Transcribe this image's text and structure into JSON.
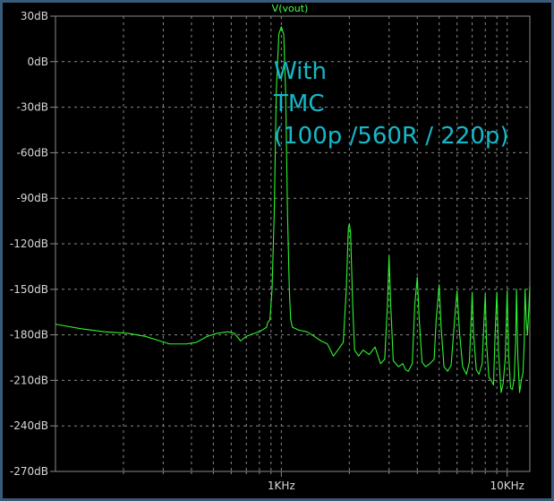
{
  "window": {
    "trace_label": "V(vout)"
  },
  "colors": {
    "background": "#000000",
    "grid": "#8a8a8a",
    "trace": "#2ef52e",
    "annotation": "#16b8c8",
    "axis_text": "#d8d8d8",
    "frame": "#3a5a7a"
  },
  "chart_data": {
    "type": "line",
    "title": "V(vout)",
    "xscale": "log",
    "xlim": [
      100,
      12600
    ],
    "ylim": [
      -270,
      30
    ],
    "x_ticks": [
      {
        "value": 1000,
        "label": "1KHz"
      },
      {
        "value": 10000,
        "label": "10KHz"
      }
    ],
    "y_ticks": [
      {
        "value": 30,
        "label": "30dB"
      },
      {
        "value": 0,
        "label": "0dB"
      },
      {
        "value": -30,
        "label": "-30dB"
      },
      {
        "value": -60,
        "label": "-60dB"
      },
      {
        "value": -90,
        "label": "-90dB"
      },
      {
        "value": -120,
        "label": "-120dB"
      },
      {
        "value": -150,
        "label": "-150dB"
      },
      {
        "value": -180,
        "label": "-180dB"
      },
      {
        "value": -210,
        "label": "-210dB"
      },
      {
        "value": -240,
        "label": "-240dB"
      },
      {
        "value": -270,
        "label": "-270dB"
      }
    ],
    "grid": true,
    "annotation": [
      "With",
      "TMC",
      "(100p /560R / 220p)"
    ],
    "series": [
      {
        "points": [
          [
            100,
            -173
          ],
          [
            130,
            -176
          ],
          [
            165,
            -178
          ],
          [
            210,
            -179
          ],
          [
            250,
            -181
          ],
          [
            290,
            -184
          ],
          [
            320,
            -186
          ],
          [
            380,
            -186
          ],
          [
            420,
            -185
          ],
          [
            470,
            -181
          ],
          [
            520,
            -179
          ],
          [
            580,
            -178
          ],
          [
            620,
            -179
          ],
          [
            660,
            -184
          ],
          [
            700,
            -181
          ],
          [
            760,
            -179
          ],
          [
            800,
            -178
          ],
          [
            840,
            -176
          ],
          [
            860,
            -175
          ],
          [
            870,
            -172
          ],
          [
            890,
            -170
          ],
          [
            910,
            -150
          ],
          [
            930,
            -100
          ],
          [
            950,
            -20
          ],
          [
            975,
            18
          ],
          [
            1000,
            23
          ],
          [
            1025,
            18
          ],
          [
            1045,
            -20
          ],
          [
            1065,
            -100
          ],
          [
            1085,
            -150
          ],
          [
            1100,
            -170
          ],
          [
            1120,
            -175
          ],
          [
            1200,
            -177
          ],
          [
            1300,
            -178
          ],
          [
            1400,
            -181
          ],
          [
            1500,
            -184
          ],
          [
            1600,
            -186
          ],
          [
            1700,
            -194
          ],
          [
            1800,
            -189
          ],
          [
            1880,
            -185
          ],
          [
            1940,
            -150
          ],
          [
            1980,
            -110
          ],
          [
            2000,
            -107
          ],
          [
            2025,
            -112
          ],
          [
            2070,
            -160
          ],
          [
            2110,
            -190
          ],
          [
            2200,
            -194
          ],
          [
            2300,
            -190
          ],
          [
            2450,
            -193
          ],
          [
            2600,
            -188
          ],
          [
            2750,
            -199
          ],
          [
            2870,
            -196
          ],
          [
            2950,
            -160
          ],
          [
            3000,
            -128
          ],
          [
            3050,
            -160
          ],
          [
            3130,
            -197
          ],
          [
            3300,
            -201
          ],
          [
            3450,
            -199
          ],
          [
            3550,
            -203
          ],
          [
            3650,
            -204
          ],
          [
            3800,
            -199
          ],
          [
            3900,
            -160
          ],
          [
            4000,
            -142
          ],
          [
            4080,
            -170
          ],
          [
            4200,
            -198
          ],
          [
            4350,
            -201
          ],
          [
            4550,
            -199
          ],
          [
            4750,
            -196
          ],
          [
            4850,
            -170
          ],
          [
            5000,
            -147
          ],
          [
            5100,
            -175
          ],
          [
            5250,
            -201
          ],
          [
            5450,
            -204
          ],
          [
            5650,
            -200
          ],
          [
            5850,
            -170
          ],
          [
            6000,
            -151
          ],
          [
            6150,
            -178
          ],
          [
            6350,
            -201
          ],
          [
            6600,
            -206
          ],
          [
            6800,
            -198
          ],
          [
            6950,
            -165
          ],
          [
            7000,
            -152
          ],
          [
            7100,
            -180
          ],
          [
            7300,
            -203
          ],
          [
            7500,
            -206
          ],
          [
            7750,
            -199
          ],
          [
            7900,
            -170
          ],
          [
            8000,
            -153
          ],
          [
            8100,
            -185
          ],
          [
            8300,
            -208
          ],
          [
            8500,
            -210
          ],
          [
            8700,
            -213
          ],
          [
            8850,
            -178
          ],
          [
            9000,
            -152
          ],
          [
            9150,
            -190
          ],
          [
            9400,
            -218
          ],
          [
            9600,
            -212
          ],
          [
            9800,
            -196
          ],
          [
            10000,
            -151
          ],
          [
            10150,
            -192
          ],
          [
            10350,
            -215
          ],
          [
            10550,
            -216
          ],
          [
            10750,
            -208
          ],
          [
            10900,
            -185
          ],
          [
            11000,
            -150
          ],
          [
            11150,
            -195
          ],
          [
            11350,
            -218
          ],
          [
            11550,
            -210
          ],
          [
            11750,
            -205
          ],
          [
            11900,
            -185
          ],
          [
            12000,
            -150
          ],
          [
            12150,
            -170
          ],
          [
            12300,
            -180
          ],
          [
            12450,
            -165
          ],
          [
            12600,
            -148
          ]
        ]
      }
    ]
  }
}
